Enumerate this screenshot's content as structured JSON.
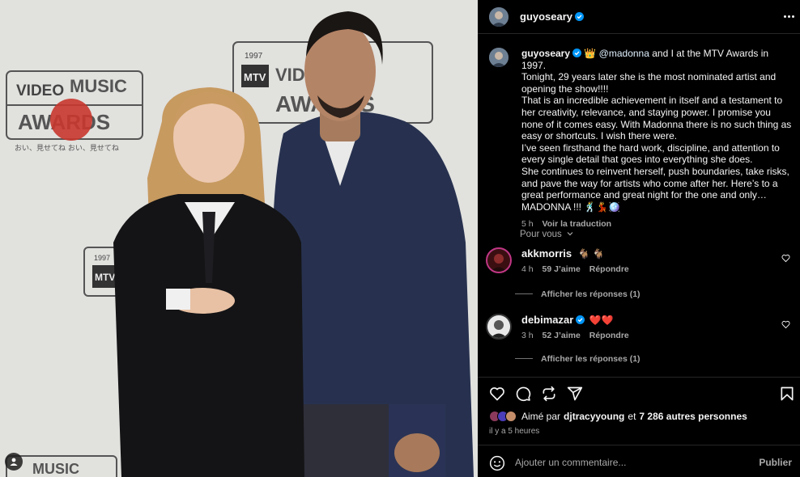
{
  "post": {
    "author": "guyoseary",
    "caption": {
      "author": "guyoseary",
      "crown": "👑",
      "mention": "@madonna",
      "lines": [
        "and I at the MTV Awards in 1997.",
        "Tonight, 29 years later she is the most nominated artist and",
        "opening the show!!!!",
        "That is an incredible achievement in itself and a testament to",
        "her creativity, relevance, and staying power. I promise you",
        "none of it comes easy. With Madonna there is no such thing as",
        "easy or shortcuts. I wish there were.",
        "I’ve seen firsthand the hard work, discipline, and attention to",
        "every single detail that goes into everything she does.",
        "She continues to reinvent herself, push boundaries, take risks,",
        "and pave the way for artists who come after her. Here’s to a",
        "great performance and great night for the one and only…",
        "MADONNA !!! 🕺💃🪩"
      ],
      "time": "5 h",
      "translate": "Voir la traduction"
    },
    "section_label": "Pour vous",
    "comments": [
      {
        "user": "akkmorris",
        "text": "🐐 🐐",
        "time": "4 h",
        "likes": "59 J’aime",
        "reply": "Répondre",
        "view_replies": "Afficher les réponses (1)"
      },
      {
        "user": "debimazar",
        "text": "❤️❤️",
        "time": "3 h",
        "likes": "52 J’aime",
        "reply": "Répondre",
        "view_replies": "Afficher les réponses (1)"
      }
    ],
    "liked_prefix": "Aimé par",
    "liked_user": "djtracyyoung",
    "liked_and": "et",
    "liked_count": "7 286 autres personnes",
    "posted_ago": "il y a 5 heures",
    "comment_placeholder": "Ajouter un commentaire...",
    "publish": "Publier"
  },
  "photo_text": {
    "year": "1997",
    "video": "VIDEO",
    "music": "MUSIC",
    "awards": "AWARDS",
    "mtv": "MTV",
    "subtitle": "おい、見せてね おい、見せてね"
  },
  "icons": [
    "verified-icon",
    "more-icon",
    "heart-icon",
    "comment-icon",
    "repost-icon",
    "share-icon",
    "bookmark-icon",
    "emoji-icon",
    "user-tag-icon",
    "chevron-down-icon"
  ],
  "colors": {
    "background": "#000000",
    "text": "#f5f5f5",
    "muted": "#a8a8a8",
    "verified": "#0095f6",
    "heart": "#ff3040"
  }
}
